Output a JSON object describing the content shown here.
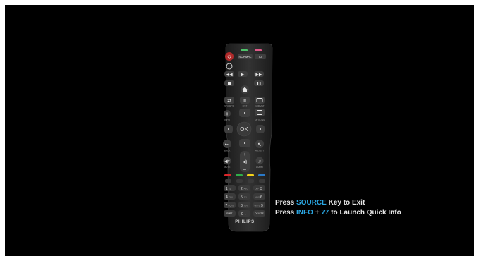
{
  "remote": {
    "brand": "PHILIPS",
    "normal_label": "NORMAL",
    "id_label": "ID",
    "ok_label": "OK",
    "labels": {
      "source": "SOURCE",
      "list": "LIST",
      "format": "FORMAT",
      "info": "INFO",
      "options": "OPTIONS",
      "back": "BACK",
      "adjust": "ADJUST",
      "mute": "MUTE",
      "volume": "VOL",
      "audio": "AUDIO",
      "subtitle": "SUBT.",
      "delete": "DELETE"
    },
    "keypad": [
      {
        "num": "1",
        "sub": ".@"
      },
      {
        "num": "2",
        "sub": "ABC"
      },
      {
        "num": "3",
        "sub": "DEF"
      },
      {
        "num": "4",
        "sub": "GHI"
      },
      {
        "num": "5",
        "sub": "JKL"
      },
      {
        "num": "6",
        "sub": "MNO"
      },
      {
        "num": "7",
        "sub": "PQRS"
      },
      {
        "num": "8",
        "sub": "TUV"
      },
      {
        "num": "9",
        "sub": "WXYZ"
      },
      {
        "num": "0",
        "sub": "_"
      }
    ],
    "color_keys": [
      "#d8262a",
      "#2fae49",
      "#f2d21a",
      "#2a79c8"
    ]
  },
  "instructions": {
    "line1": {
      "pre": "Press ",
      "key": "SOURCE",
      "post": " Key to Exit"
    },
    "line2": {
      "pre": "Press ",
      "key1": "INFO",
      "mid": " + ",
      "key2": "77",
      "post": " to Launch Quick Info"
    }
  },
  "colors": {
    "accent": "#2aa6e2",
    "background": "#000000",
    "text": "#e6e6e6",
    "remote_body": "#2b2b2b"
  }
}
